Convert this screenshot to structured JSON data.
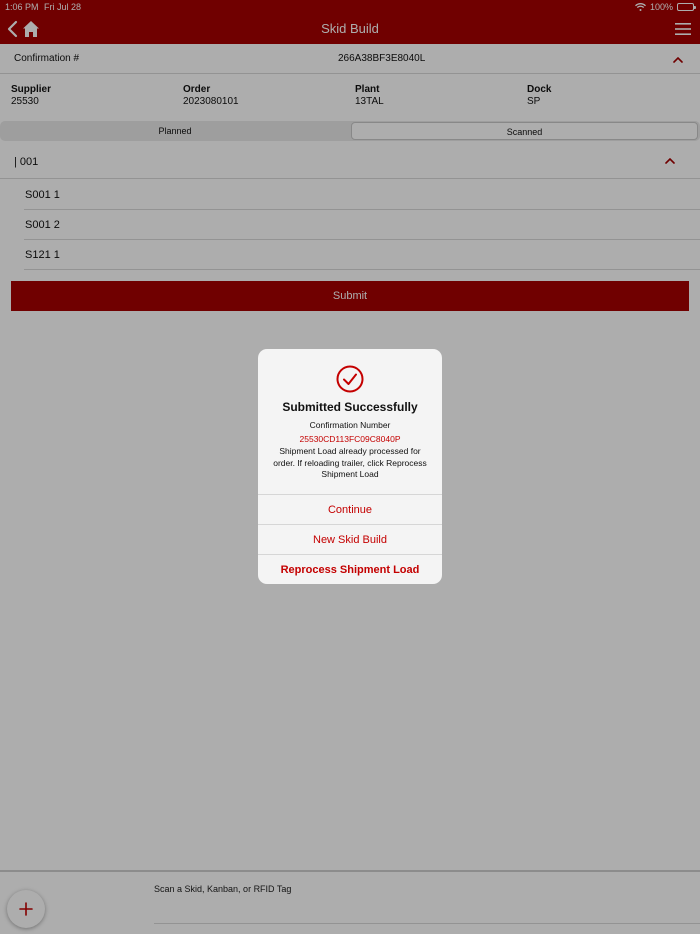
{
  "status_bar": {
    "time": "1:06 PM",
    "date": "Fri Jul 28",
    "battery": "100%"
  },
  "nav": {
    "title": "Skid Build"
  },
  "confirmation": {
    "label": "Confirmation #",
    "value": "266A38BF3E8040L"
  },
  "info": {
    "supplier": {
      "label": "Supplier",
      "value": "25530"
    },
    "order": {
      "label": "Order",
      "value": "2023080101"
    },
    "plant": {
      "label": "Plant",
      "value": "13TAL"
    },
    "dock": {
      "label": "Dock",
      "value": "SP"
    }
  },
  "segments": {
    "planned": "Planned",
    "scanned": "Scanned",
    "selected": "Scanned"
  },
  "group": {
    "name": "| 001"
  },
  "items": [
    "S001 1",
    "S001 2",
    "S121 1"
  ],
  "submit_label": "Submit",
  "scan": {
    "placeholder": "Scan a Skid, Kanban, or RFID Tag"
  },
  "dialog": {
    "title": "Submitted Successfully",
    "subtitle": "Confirmation Number",
    "code": "25530CD113FC09C8040P",
    "message": "Shipment Load already processed for order. If reloading trailer, click Reprocess Shipment Load",
    "buttons": {
      "continue": "Continue",
      "new_skid": "New Skid Build",
      "reprocess": "Reprocess Shipment Load"
    }
  },
  "colors": {
    "brand": "#a50000",
    "accent_text": "#c40000",
    "overlay": "rgba(0,0,0,0.32)"
  },
  "icons": [
    "back-chevron-icon",
    "home-icon",
    "menu-icon",
    "chevron-up-icon",
    "check-circle-icon",
    "plus-icon",
    "wifi-icon",
    "battery-icon"
  ]
}
